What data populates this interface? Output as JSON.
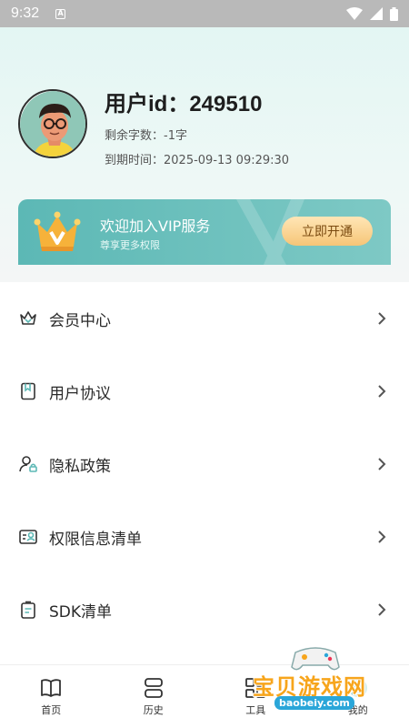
{
  "status_bar": {
    "time": "9:32"
  },
  "profile": {
    "user_id": "用户id：249510",
    "remaining_chars": "剩余字数：-1字",
    "expire_time": "到期时间：2025-09-13 09:29:30"
  },
  "vip": {
    "title": "欢迎加入VIP服务",
    "subtitle": "尊享更多权限",
    "button": "立即开通"
  },
  "menu": [
    {
      "label": "会员中心",
      "icon": "crown-icon"
    },
    {
      "label": "用户协议",
      "icon": "bookmark-icon"
    },
    {
      "label": "隐私政策",
      "icon": "user-lock-icon"
    },
    {
      "label": "权限信息清单",
      "icon": "id-card-icon"
    },
    {
      "label": "SDK清单",
      "icon": "clipboard-icon"
    }
  ],
  "tabs": [
    {
      "label": "首页",
      "icon": "book-icon"
    },
    {
      "label": "历史",
      "icon": "history-icon"
    },
    {
      "label": "工具",
      "icon": "tools-icon"
    },
    {
      "label": "我的",
      "icon": "profile-icon"
    }
  ],
  "watermark": {
    "text": "宝贝游戏网",
    "url": "baobeiy.com"
  },
  "colors": {
    "accent": "#5cb8b5",
    "vip_button": "#f6c577"
  }
}
